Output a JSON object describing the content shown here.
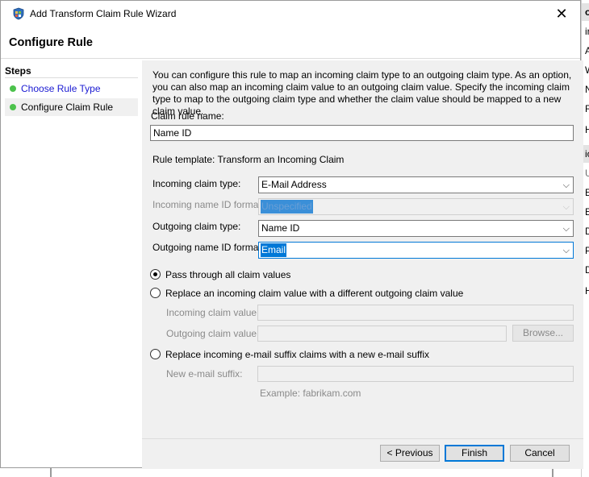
{
  "window": {
    "title": "Add Transform Claim Rule Wizard",
    "close_glyph": "✕",
    "icon": "wizard-shield-icon"
  },
  "header": {
    "title": "Configure Rule"
  },
  "steps": {
    "label": "Steps",
    "items": [
      {
        "label": "Choose Rule Type",
        "state": "link"
      },
      {
        "label": "Configure Claim Rule",
        "state": "current"
      }
    ]
  },
  "content": {
    "description": "You can configure this rule to map an incoming claim type to an outgoing claim type. As an option, you can also map an incoming claim value to an outgoing claim value. Specify the incoming claim type to map to the outgoing claim type and whether the claim value should be mapped to a new claim value.",
    "claim_rule_name_label": "Claim rule name:",
    "claim_rule_name_value": "Name ID",
    "rule_template": "Rule template: Transform an Incoming Claim",
    "incoming_claim_type_label": "Incoming claim type:",
    "incoming_claim_type_value": "E-Mail Address",
    "incoming_name_id_format_label": "Incoming name ID format:",
    "incoming_name_id_format_value": "Unspecified",
    "outgoing_claim_type_label": "Outgoing claim type:",
    "outgoing_claim_type_value": "Name ID",
    "outgoing_name_id_format_label": "Outgoing name ID format:",
    "outgoing_name_id_format_value": "Email",
    "radio_pass_through": "Pass through all claim values",
    "radio_replace_value": "Replace an incoming claim value with a different outgoing claim value",
    "incoming_claim_value_label": "Incoming claim value:",
    "outgoing_claim_value_label": "Outgoing claim value:",
    "browse_label": "Browse...",
    "radio_replace_suffix": "Replace incoming e-mail suffix claims with a new e-mail suffix",
    "new_suffix_label": "New e-mail suffix:",
    "example_text": "Example: fabrikam.com"
  },
  "footer": {
    "previous_label": "< Previous",
    "finish_label": "Finish",
    "cancel_label": "Cancel"
  },
  "background_window": {
    "rows": [
      "or",
      "ir",
      "A",
      "W",
      "N",
      "R",
      "H",
      "io",
      "U",
      "E",
      "E",
      "D",
      "P",
      "D",
      "H"
    ]
  }
}
